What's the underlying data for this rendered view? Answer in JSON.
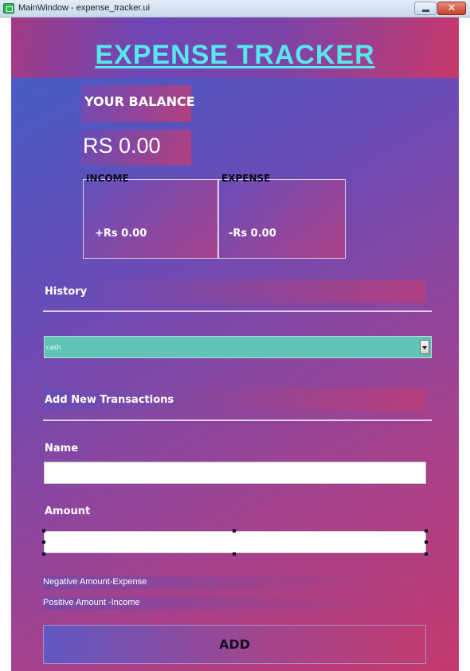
{
  "window": {
    "title": "MainWindow - expense_tracker.ui",
    "close_glyph": "✕"
  },
  "header": {
    "title": "EXPENSE TRACKER"
  },
  "balance": {
    "label": "YOUR BALANCE",
    "value": "RS 0.00"
  },
  "income": {
    "label": "INCOME",
    "value": "+Rs 0.00"
  },
  "expense": {
    "label": "EXPENSE",
    "value": "-Rs  0.00"
  },
  "history": {
    "label": "History",
    "combo_value": "cash"
  },
  "add_section": {
    "label": "Add New Transactions"
  },
  "form": {
    "name_label": "Name",
    "name_value": "",
    "amount_label": "Amount",
    "amount_value": ""
  },
  "hints": {
    "negative": "Negative Amount-Expense",
    "positive": "Positive Amount -Income"
  },
  "add_button": {
    "label": "ADD"
  },
  "colors": {
    "title_cyan": "#57e8ee",
    "combo_teal": "#5fc4b6",
    "gradient_blue": "#3f5fc8",
    "gradient_pink": "#c43a6f"
  },
  "icons": {
    "app": "app-window-icon",
    "minimize": "minimize-icon",
    "close": "close-icon",
    "combo_arrow": "chevron-down-icon"
  }
}
